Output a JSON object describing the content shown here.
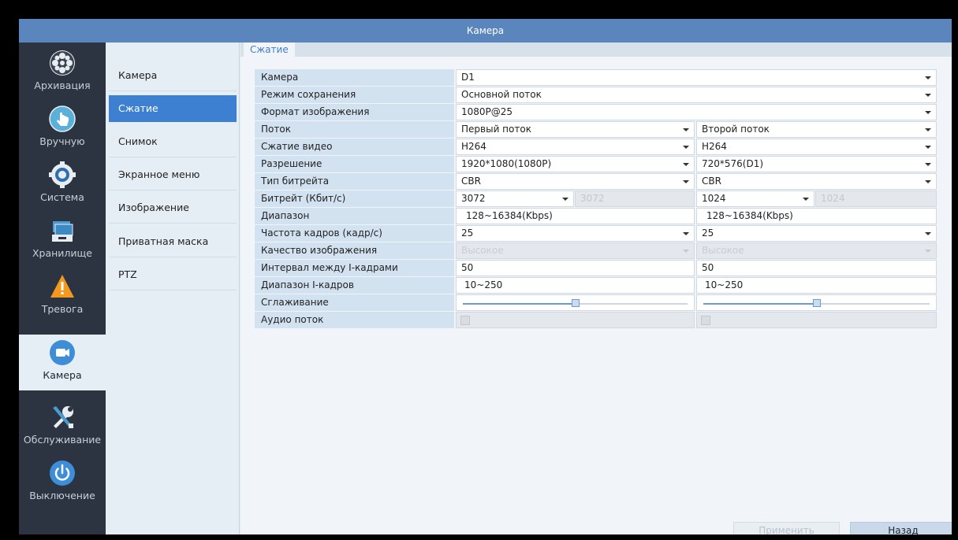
{
  "window": {
    "title": "Камера"
  },
  "sidebar": {
    "items": [
      {
        "label": "Архивация",
        "icon": "film-reel-icon"
      },
      {
        "label": "Вручную",
        "icon": "hand-pointer-icon"
      },
      {
        "label": "Система",
        "icon": "gear-icon"
      },
      {
        "label": "Хранилище",
        "icon": "storage-icon"
      },
      {
        "label": "Тревога",
        "icon": "alarm-warning-icon"
      },
      {
        "label": "Камера",
        "icon": "camera-icon",
        "active": true
      },
      {
        "label": "Обслуживание",
        "icon": "tools-icon"
      },
      {
        "label": "Выключение",
        "icon": "power-icon"
      }
    ]
  },
  "submenu": {
    "items": [
      {
        "label": "Камера"
      },
      {
        "label": "Сжатие",
        "active": true
      },
      {
        "label": "Снимок"
      },
      {
        "label": "Экранное меню"
      },
      {
        "label": "Изображение"
      },
      {
        "label": "Приватная маска"
      },
      {
        "label": "PTZ"
      }
    ]
  },
  "content": {
    "tab": "Сжатие",
    "labels": {
      "camera": "Камера",
      "save_mode": "Режим сохранения",
      "image_format": "Формат изображения",
      "stream": "Поток",
      "video_compression": "Сжатие видео",
      "resolution": "Разрешение",
      "bitrate_type": "Тип битрейта",
      "bitrate": "Битрейт (Кбит/с)",
      "range": "Диапазон",
      "frame_rate": "Частота кадров (кадр/с)",
      "image_quality": "Качество изображения",
      "iframe_interval": "Интервал между I-кадрами",
      "iframe_range": "Диапазон I-кадров",
      "smoothing": "Сглаживание",
      "audio_stream": "Аудио поток"
    },
    "values": {
      "camera": "D1",
      "save_mode": "Основной поток",
      "image_format": "1080P@25"
    },
    "main": {
      "stream": "Первый поток",
      "video_compression": "H264",
      "resolution": "1920*1080(1080P)",
      "bitrate_type": "CBR",
      "bitrate": "3072",
      "bitrate_custom": "3072",
      "range": "128~16384(Kbps)",
      "frame_rate": "25",
      "image_quality": "Высокое",
      "iframe_interval": "50",
      "iframe_range": "10~250",
      "smoothing_level": 0.5,
      "audio_enabled": false
    },
    "sub": {
      "stream": "Второй поток",
      "video_compression": "H264",
      "resolution": "720*576(D1)",
      "bitrate_type": "CBR",
      "bitrate": "1024",
      "bitrate_custom": "1024",
      "range": "128~16384(Kbps)",
      "frame_rate": "25",
      "image_quality": "Высокое",
      "iframe_interval": "50",
      "iframe_range": "10~250",
      "smoothing_level": 0.5,
      "audio_enabled": false
    }
  },
  "buttons": {
    "apply": "Применить",
    "back": "Назад"
  },
  "colors": {
    "titlebar": "#5b86bd",
    "sidebar": "#2b3440",
    "accent": "#3d7fd0",
    "label_bg": "#d3e2f0"
  }
}
